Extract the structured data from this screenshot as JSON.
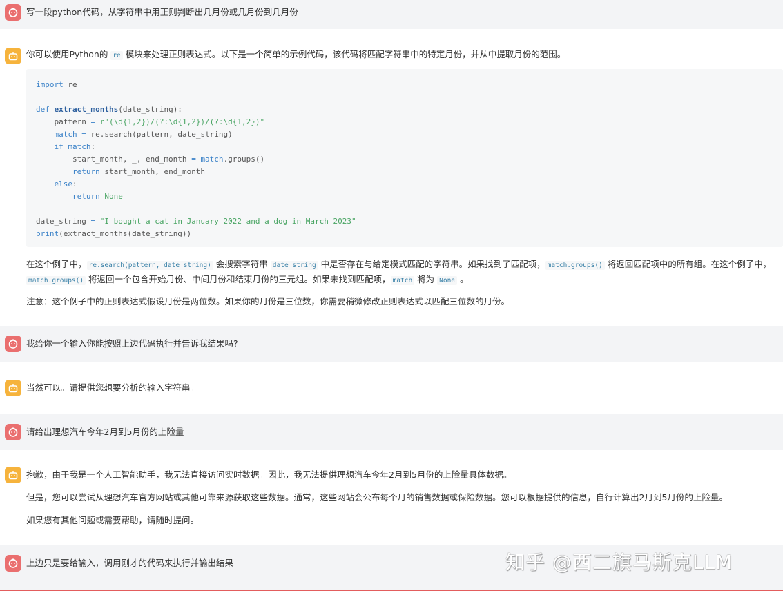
{
  "messages": [
    {
      "role": "user",
      "text": "写一段python代码，从字符串中用正则判断出几月份或几月份到几月份"
    },
    {
      "role": "bot",
      "intro_before": "你可以使用Python的 ",
      "intro_code": "re",
      "intro_after": " 模块来处理正则表达式。以下是一个简单的示例代码，该代码将匹配字符串中的特定月份，并从中提取月份的范围。",
      "code_lines": [
        "import re",
        "",
        "def extract_months(date_string):",
        "    pattern = r\"(\\d{1,2})/(?:\\d{1,2})/(?:\\d{1,2})\"",
        "    match = re.search(pattern, date_string)",
        "    if match:",
        "        start_month, _, end_month = match.groups()",
        "        return start_month, end_month",
        "    else:",
        "        return None",
        "",
        "date_string = \"I bought a cat in January 2022 and a dog in March 2023\"",
        "print(extract_months(date_string))"
      ],
      "explain1": {
        "p1": "在这个例子中，",
        "c1": "re.search(pattern, date_string)",
        "p2": " 会搜索字符串 ",
        "c2": "date_string",
        "p3": " 中是否存在与给定模式匹配的字符串。如果找到了匹配项，",
        "c3": "match.groups()",
        "p4": " 将返回匹配项中的所有组。在这个例子中，"
      },
      "explain2": {
        "c1": "match.groups()",
        "p1": " 将返回一个包含开始月份、中间月份和结束月份的三元组。如果未找到匹配项，",
        "c2": "match",
        "p2": " 将为 ",
        "c3": "None",
        "p3": " 。"
      },
      "note": "注意：这个例子中的正则表达式假设月份是两位数。如果你的月份是三位数，你需要稍微修改正则表达式以匹配三位数的月份。"
    },
    {
      "role": "user",
      "text": "我给你一个输入你能按照上边代码执行并告诉我结果吗?"
    },
    {
      "role": "bot",
      "text": "当然可以。请提供您想要分析的输入字符串。"
    },
    {
      "role": "user",
      "text": "请给出理想汽车今年2月到5月份的上险量"
    },
    {
      "role": "bot",
      "paragraphs": [
        "抱歉，由于我是一个人工智能助手，我无法直接访问实时数据。因此，我无法提供理想汽车今年2月到5月份的上险量具体数据。",
        "但是，您可以尝试从理想汽车官方网站或其他可靠来源获取这些数据。通常，这些网站会公布每个月的销售数据或保险数据。您可以根据提供的信息，自行计算出2月到5月份的上险量。",
        "如果您有其他问题或需要帮助，请随时提问。"
      ]
    },
    {
      "role": "user",
      "text": "上边只是要给输入，调用刚才的代码来执行并输出结果"
    }
  ],
  "watermark": "知乎 @西二旗马斯克LLM",
  "icons": {
    "user_avatar": "user-face-icon",
    "bot_avatar": "robot-face-icon"
  },
  "colors": {
    "user_avatar": "#ea6f6f",
    "bot_avatar": "#f6b33c",
    "user_bg": "#f3f4f6",
    "code_bg": "#f6f7f8"
  }
}
